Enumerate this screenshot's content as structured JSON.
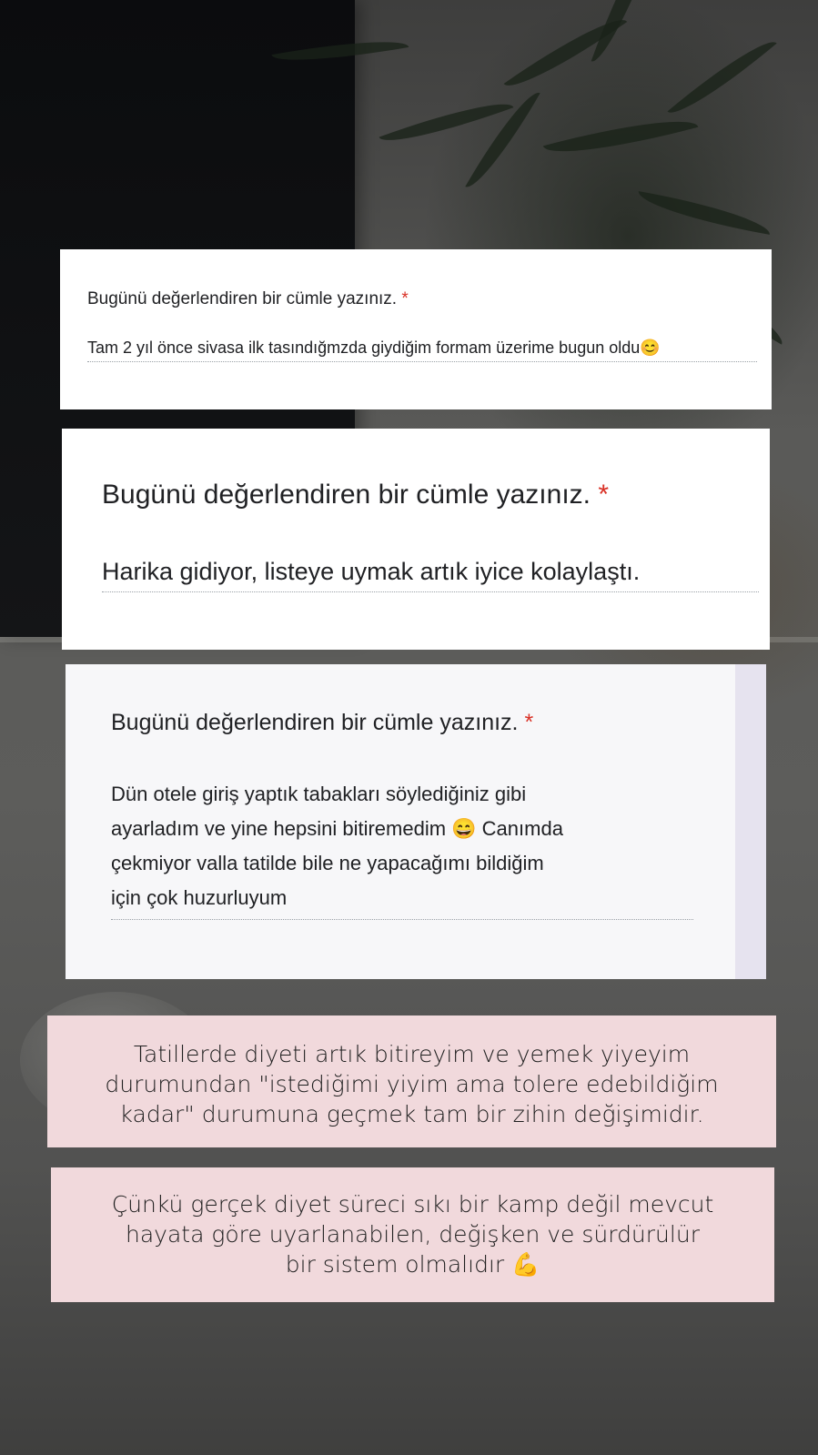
{
  "cards": [
    {
      "question": "Bugünü değerlendiren bir cümle yazınız.",
      "required_mark": "*",
      "answer": "Tam 2 yıl önce sivasa ilk tasındığmzda giydiğim formam üzerime bugun oldu😊"
    },
    {
      "question": "Bugünü değerlendiren bir cümle yazınız.",
      "required_mark": "*",
      "answer": "Harika gidiyor, listeye uymak artık iyice kolaylaştı."
    },
    {
      "question": "Bugünü değerlendiren bir cümle yazınız.",
      "required_mark": "*",
      "answer_lines": [
        "Dün otele giriş yaptık tabakları söylediğiniz gibi",
        "ayarladım ve yine hepsini bitiremedim 😄 Canımda",
        "çekmiyor valla tatilde bile ne yapacağımı bildiğim",
        "için çok huzurluyum"
      ]
    }
  ],
  "notes": [
    {
      "lines": [
        "Tatillerde diyeti artık bitireyim ve yemek yiyeyim",
        "durumundan \"istediğimi yiyim ama tolere edebildiğim",
        "kadar\" durumuna geçmek tam bir zihin değişimidir."
      ]
    },
    {
      "lines": [
        "Çünkü gerçek diyet süreci sıkı bir kamp değil mevcut",
        "hayata göre uyarlanabilen, değişken ve sürdürülür",
        "bir sistem olmalıdır 💪"
      ]
    }
  ],
  "colors": {
    "required": "#d93025",
    "note_bg": "#f1d9dc",
    "card_bg": "#ffffff"
  }
}
